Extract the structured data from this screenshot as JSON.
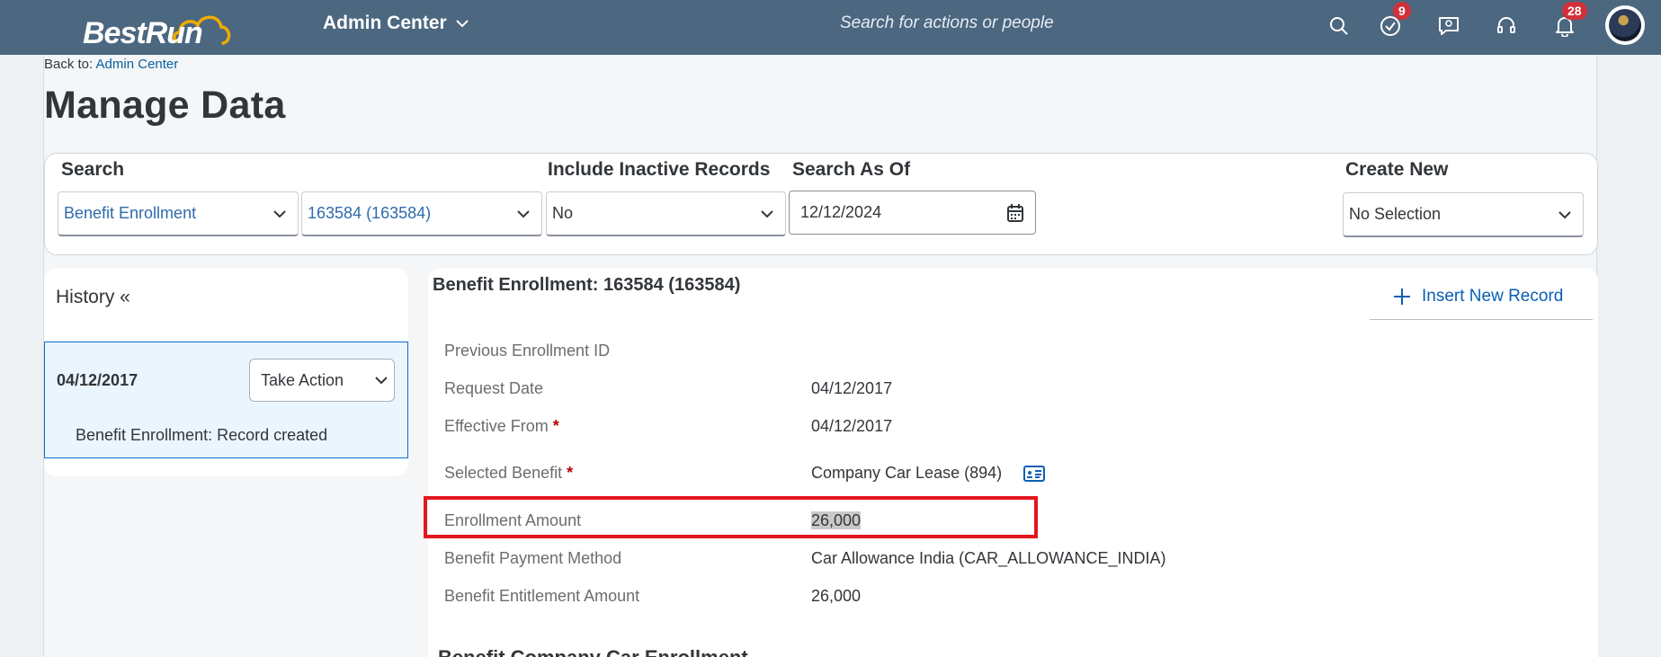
{
  "shell": {
    "logo_text": "BestRun",
    "app_title": "Admin Center",
    "search_placeholder": "Search for actions or people",
    "todo_badge": "9",
    "notification_badge": "28"
  },
  "breadcrumb": {
    "prefix": "Back to:",
    "link": "Admin Center"
  },
  "page_title": "Manage Data",
  "search_panel": {
    "search_label": "Search",
    "object_type": "Benefit Enrollment",
    "object_id": "163584 (163584)",
    "inactive_label": "Include Inactive Records",
    "inactive_value": "No",
    "asof_label": "Search As Of",
    "asof_value": "12/12/2024",
    "create_label": "Create New",
    "create_value": "No Selection"
  },
  "history": {
    "title": "History «",
    "item_date": "04/12/2017",
    "take_action": "Take Action",
    "item_desc": "Benefit Enrollment: Record created"
  },
  "detail": {
    "title": "Benefit Enrollment: 163584 (163584)",
    "insert_label": "Insert New Record",
    "fields": {
      "prev_enrollment_label": "Previous Enrollment ID",
      "request_date_label": "Request Date",
      "request_date_value": "04/12/2017",
      "effective_from_label": "Effective From",
      "effective_from_value": "04/12/2017",
      "selected_benefit_label": "Selected Benefit",
      "selected_benefit_value": "Company Car Lease (894)",
      "enrollment_amount_label": "Enrollment Amount",
      "enrollment_amount_value": "26,000",
      "payment_method_label": "Benefit Payment Method",
      "payment_method_value": "Car Allowance India (CAR_ALLOWANCE_INDIA)",
      "entitlement_label": "Benefit Entitlement Amount",
      "entitlement_value": "26,000"
    },
    "next_section_title": "Benefit Company Car Enrollment"
  },
  "colors": {
    "shell": "#4c6780",
    "accent": "#0a6ed1",
    "highlight_box": "#e2161d",
    "required": "#bb0000"
  }
}
